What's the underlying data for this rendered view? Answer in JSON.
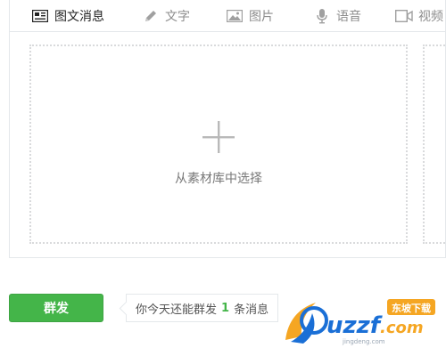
{
  "tabs": [
    {
      "label": "图文消息",
      "icon": "news-icon",
      "active": true
    },
    {
      "label": "文字",
      "icon": "pencil-icon",
      "active": false
    },
    {
      "label": "图片",
      "icon": "image-icon",
      "active": false
    },
    {
      "label": "语音",
      "icon": "microphone-icon",
      "active": false
    },
    {
      "label": "视频",
      "icon": "video-icon",
      "active": false
    }
  ],
  "picker": {
    "label": "从素材库中选择",
    "icon": "plus-icon"
  },
  "actions": {
    "send_label": "群发",
    "quota_prefix": "你今天还能群发",
    "quota_count": "1",
    "quota_suffix": "条消息"
  },
  "watermark": {
    "brand": "uzzf.com",
    "tagline": "东坡下载",
    "url": "jingdeng.com"
  },
  "colors": {
    "accent": "#44b549",
    "border": "#e4e8eb",
    "dotted": "#d9dadc",
    "watermark_blue": "#1a6fd6",
    "watermark_orange": "#f5a623"
  }
}
